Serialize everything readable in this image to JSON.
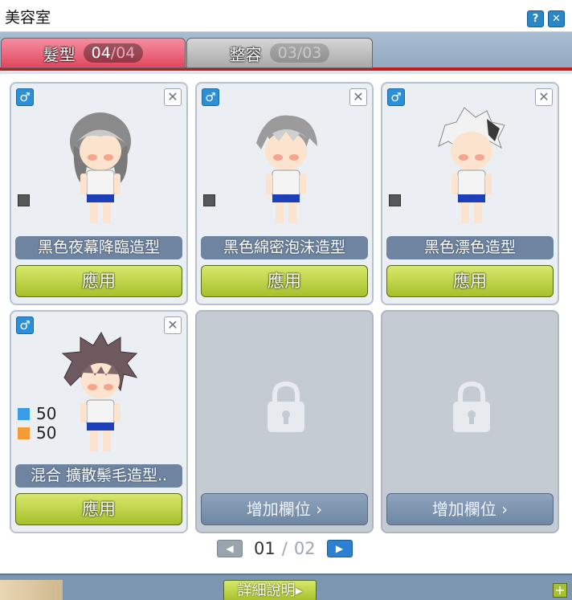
{
  "window": {
    "title": "美容室"
  },
  "tabs": [
    {
      "label": "髮型",
      "current": "04",
      "slash": "/",
      "max": "04"
    },
    {
      "label": "整容",
      "current": "03",
      "slash": "/",
      "max": "03"
    }
  ],
  "slots": [
    {
      "gender": "♂",
      "remove": "✕",
      "name": "黑色夜幕降臨造型",
      "apply": "應用",
      "color": "#575757"
    },
    {
      "gender": "♂",
      "remove": "✕",
      "name": "黑色綿密泡沫造型",
      "apply": "應用",
      "color": "#575757"
    },
    {
      "gender": "♂",
      "remove": "✕",
      "name": "黑色漂色造型",
      "apply": "應用",
      "color": "#575757"
    },
    {
      "gender": "♂",
      "remove": "✕",
      "name": "混合 擴散鬃毛造型..",
      "apply": "應用",
      "mix": [
        {
          "color": "#3a9ee4",
          "value": "50"
        },
        {
          "color": "#f39b34",
          "value": "50"
        }
      ]
    },
    {
      "locked": true,
      "add": "增加欄位 ›"
    },
    {
      "locked": true,
      "add": "增加欄位 ›"
    }
  ],
  "pagination": {
    "prev": "◀",
    "next": "▶",
    "current": "01",
    "slash": "/",
    "total": "02"
  },
  "footer": {
    "detail": "詳細說明▸",
    "expand": "+"
  }
}
